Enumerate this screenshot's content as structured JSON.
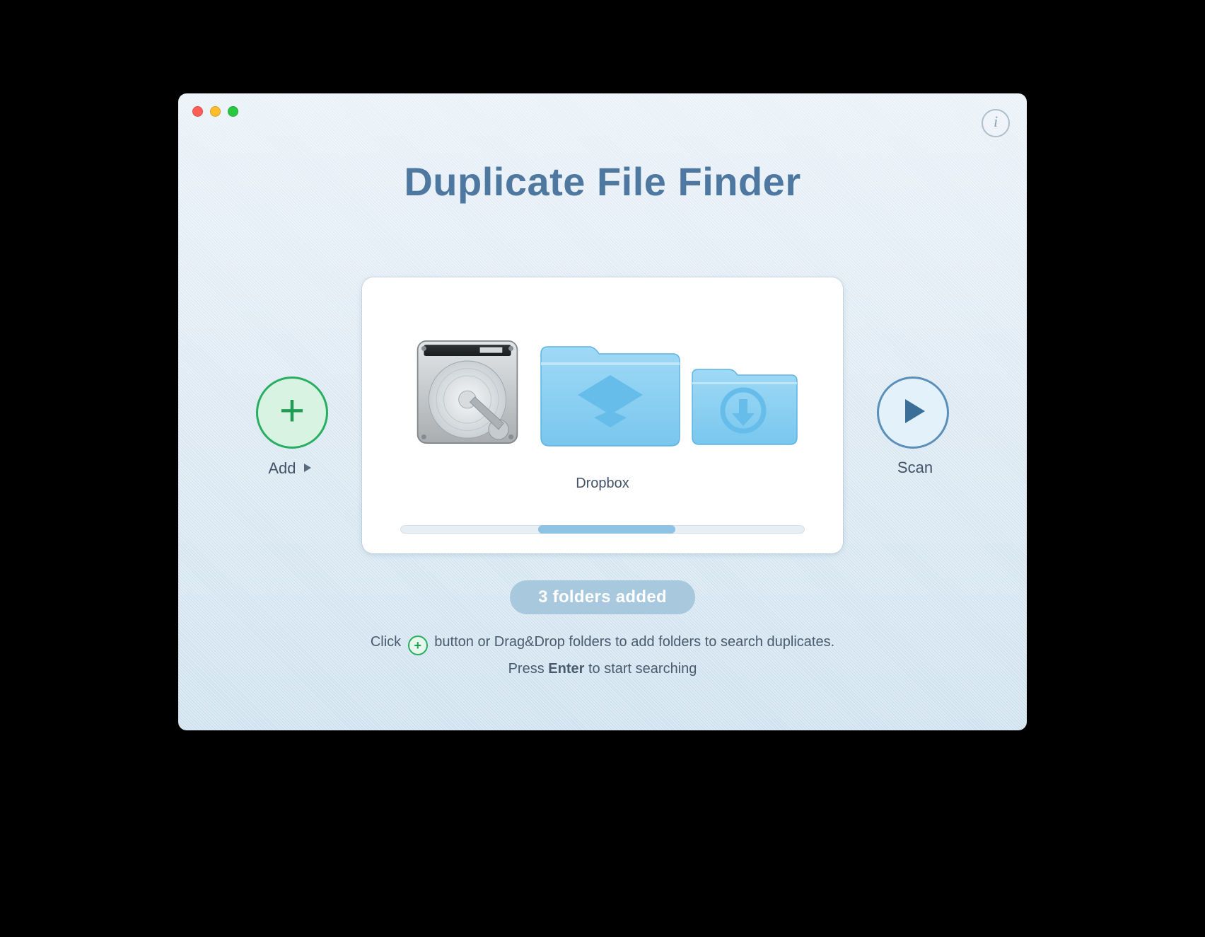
{
  "app": {
    "title": "Duplicate File Finder"
  },
  "window": {
    "info_glyph": "i"
  },
  "buttons": {
    "add_label": "Add",
    "scan_label": "Scan"
  },
  "card": {
    "center_caption": "Dropbox"
  },
  "status": {
    "pill": "3 folders added"
  },
  "hints": {
    "line1_before": "Click",
    "line1_after": "button or Drag&Drop folders to add folders to search duplicates.",
    "line2_before": "Press",
    "line2_bold": "Enter",
    "line2_after": "to start searching"
  }
}
